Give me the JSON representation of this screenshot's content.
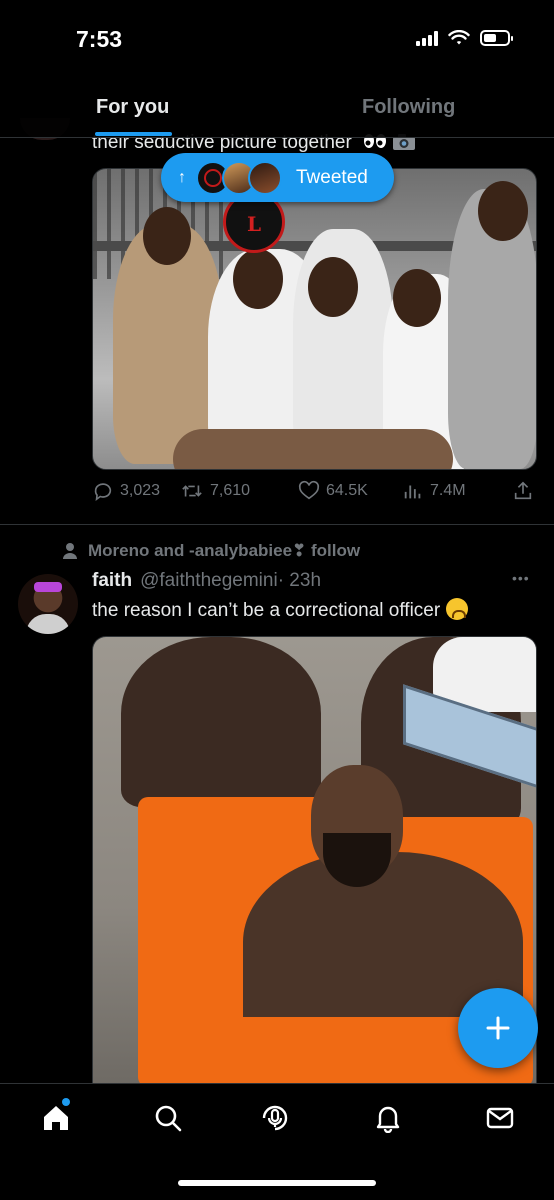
{
  "status_bar": {
    "time": "7:53"
  },
  "tabs": [
    {
      "label": "For you",
      "active": true
    },
    {
      "label": "Following",
      "active": false
    }
  ],
  "tweet1": {
    "text": "their seductive picture together",
    "emojis": [
      "eyes-emoji",
      "camera-emoji"
    ],
    "stats": {
      "replies": "3,023",
      "retweets": "7,610",
      "likes": "64.5K",
      "views": "7.4M"
    }
  },
  "tweeted_pill": {
    "label": "Tweeted"
  },
  "tweet2": {
    "social_context": "Moreno and -analybabiee❣ follow",
    "display_name": "faith",
    "handle": "@faiththegemini",
    "time": "· 23h",
    "text": "the reason I can’t be a correctional officer",
    "emoji": "weary-face-emoji"
  },
  "colors": {
    "accent": "#1d9bf0",
    "muted": "#71767b",
    "text": "#e7e9ea",
    "background": "#000000"
  },
  "nav": [
    "home-icon",
    "search-icon",
    "spaces-icon",
    "notifications-icon",
    "messages-icon"
  ]
}
